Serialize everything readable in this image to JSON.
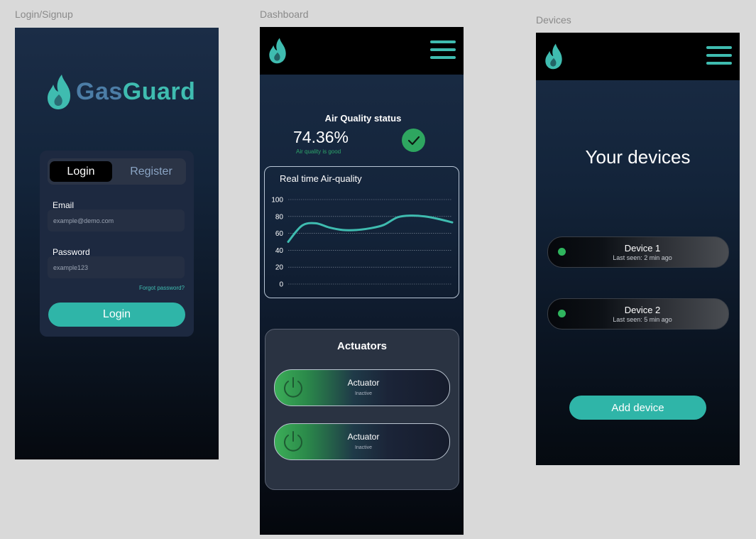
{
  "frames": {
    "login_label": "Login/Signup",
    "dashboard_label": "Dashboard",
    "devices_label": "Devices"
  },
  "login": {
    "logo": {
      "part1": "Gas",
      "part2": "Guard",
      "icon": "flame-icon"
    },
    "tabs": {
      "active": "Login",
      "inactive": "Register"
    },
    "email_label": "Email",
    "email_placeholder": "example@demo.com",
    "password_label": "Password",
    "password_placeholder": "example123",
    "forgot": "Forgot password?",
    "button": "Login"
  },
  "dashboard": {
    "logo_icon": "flame-icon",
    "menu_icon": "hamburger-menu-icon",
    "aq_title": "Air Quality status",
    "aq_value": "74.36%",
    "aq_sub": "Air quality is good",
    "check_icon": "check-icon",
    "actuators_title": "Actuators",
    "actuators": [
      {
        "name": "Actuator",
        "status": "Inactive",
        "icon": "power-icon"
      },
      {
        "name": "Actuator",
        "status": "Inactive",
        "icon": "power-icon"
      }
    ]
  },
  "chart_data": {
    "type": "line",
    "title": "Real time Air-quality",
    "ylim": [
      0,
      100
    ],
    "yticks": [
      "100",
      "80",
      "60",
      "40",
      "20",
      "0"
    ],
    "x": [
      0,
      1,
      2,
      3,
      4,
      5,
      6,
      7,
      8,
      9,
      10,
      11,
      12
    ],
    "series": [
      {
        "values": [
          50,
          69,
          72,
          67,
          64,
          64,
          66,
          70,
          79,
          81,
          80,
          77,
          73
        ]
      }
    ],
    "grid": true,
    "line_color": "#3fbcb0"
  },
  "devices": {
    "logo_icon": "flame-icon",
    "menu_icon": "hamburger-menu-icon",
    "title": "Your devices",
    "list": [
      {
        "name": "Device 1",
        "seen": "Last seen: 2 min ago"
      },
      {
        "name": "Device 2",
        "seen": "Last seen: 5 min ago"
      }
    ],
    "add_button": "Add device"
  },
  "colors": {
    "accent": "#2fb5a8",
    "brand_blue": "#4c7da6",
    "status_good": "#2ea660"
  }
}
